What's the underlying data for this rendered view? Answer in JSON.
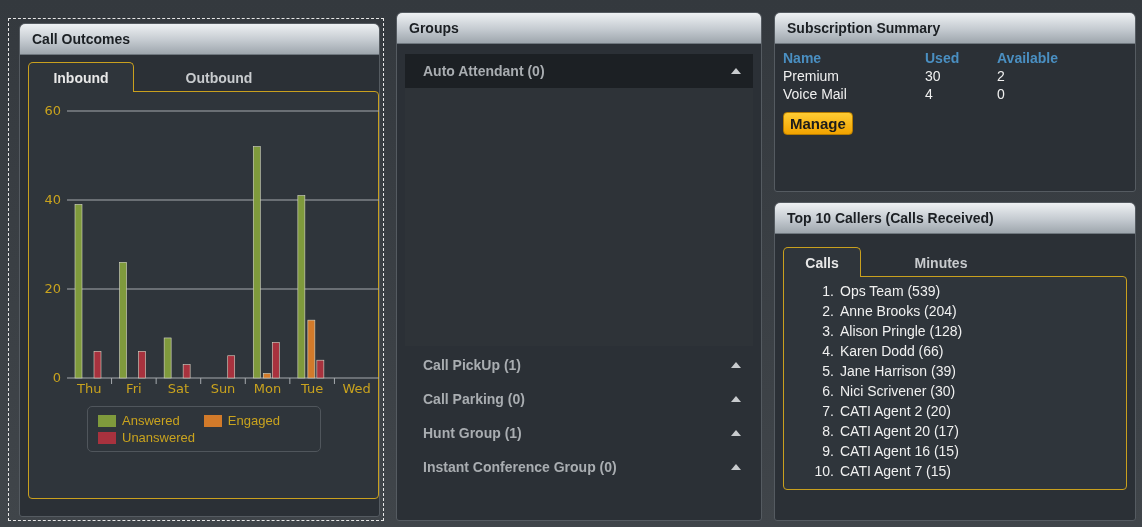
{
  "call_outcomes": {
    "title": "Call Outcomes",
    "tabs": [
      {
        "label": "Inbound",
        "selected": true
      },
      {
        "label": "Outbound",
        "selected": false
      }
    ],
    "chart_data": {
      "type": "bar",
      "categories": [
        "Thu",
        "Fri",
        "Sat",
        "Sun",
        "Mon",
        "Tue",
        "Wed"
      ],
      "series": [
        {
          "name": "Answered",
          "color": "#7f9a3c",
          "values": [
            39,
            26,
            9,
            0,
            52,
            41,
            0
          ]
        },
        {
          "name": "Engaged",
          "color": "#d27a2a",
          "values": [
            0,
            0,
            0,
            0,
            1,
            13,
            0
          ]
        },
        {
          "name": "Unanswered",
          "color": "#a8323e",
          "values": [
            6,
            6,
            3,
            5,
            8,
            4,
            0
          ]
        }
      ],
      "ylim": [
        0,
        60
      ],
      "yticks": [
        0,
        20,
        40,
        60
      ],
      "legend": "bottom"
    }
  },
  "groups": {
    "title": "Groups",
    "items": [
      {
        "label": "Auto Attendant (0)",
        "expanded": true
      },
      {
        "label": "Call PickUp (1)",
        "expanded": false
      },
      {
        "label": "Call Parking (0)",
        "expanded": false
      },
      {
        "label": "Hunt Group (1)",
        "expanded": false
      },
      {
        "label": "Instant Conference Group (0)",
        "expanded": false
      }
    ]
  },
  "subscription_summary": {
    "title": "Subscription Summary",
    "columns": [
      "Name",
      "Used",
      "Available"
    ],
    "rows": [
      [
        "Premium",
        "30",
        "2"
      ],
      [
        "Voice Mail",
        "4",
        "0"
      ]
    ],
    "button": "Manage"
  },
  "top_callers": {
    "title": "Top 10 Callers (Calls Received)",
    "tabs": [
      {
        "label": "Calls",
        "selected": true
      },
      {
        "label": "Minutes",
        "selected": false
      }
    ],
    "items": [
      {
        "rank": "1.",
        "name": "Ops Team (539)"
      },
      {
        "rank": "2.",
        "name": "Anne Brooks (204)"
      },
      {
        "rank": "3.",
        "name": "Alison Pringle (128)"
      },
      {
        "rank": "4.",
        "name": "Karen Dodd (66)"
      },
      {
        "rank": "5.",
        "name": "Jane Harrison (39)"
      },
      {
        "rank": "6.",
        "name": "Nici Scrivener (30)"
      },
      {
        "rank": "7.",
        "name": "CATI Agent 2 (20)"
      },
      {
        "rank": "8.",
        "name": "CATI Agent 20 (17)"
      },
      {
        "rank": "9.",
        "name": "CATI Agent 16 (15)"
      },
      {
        "rank": "10.",
        "name": "CATI Agent 7 (15)"
      }
    ]
  }
}
